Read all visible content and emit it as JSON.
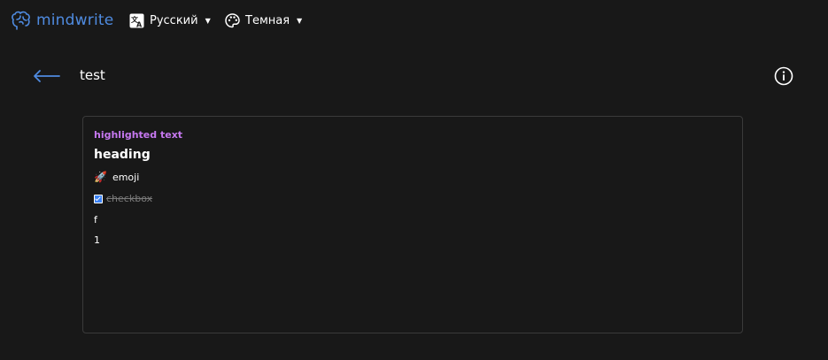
{
  "header": {
    "brand": "mindwrite",
    "language_label": "Русский",
    "theme_label": "Темная"
  },
  "note": {
    "title": "test"
  },
  "editor": {
    "highlighted_text": "highlighted text",
    "heading": "heading",
    "emoji_glyph": "🚀",
    "emoji_text": "emoji",
    "checkbox_label": "checkbox",
    "checkbox_checked": true,
    "line_f": "f",
    "line_1": "1"
  },
  "colors": {
    "background": "#181818",
    "brand": "#4f8be0",
    "highlight": "#c678f0",
    "checkbox": "#3b82f6",
    "border": "#3a3a3a"
  },
  "icons": {
    "brand": "brain-icon",
    "language": "translate-icon",
    "theme": "palette-icon",
    "back": "arrow-left-icon",
    "info": "info-icon"
  }
}
